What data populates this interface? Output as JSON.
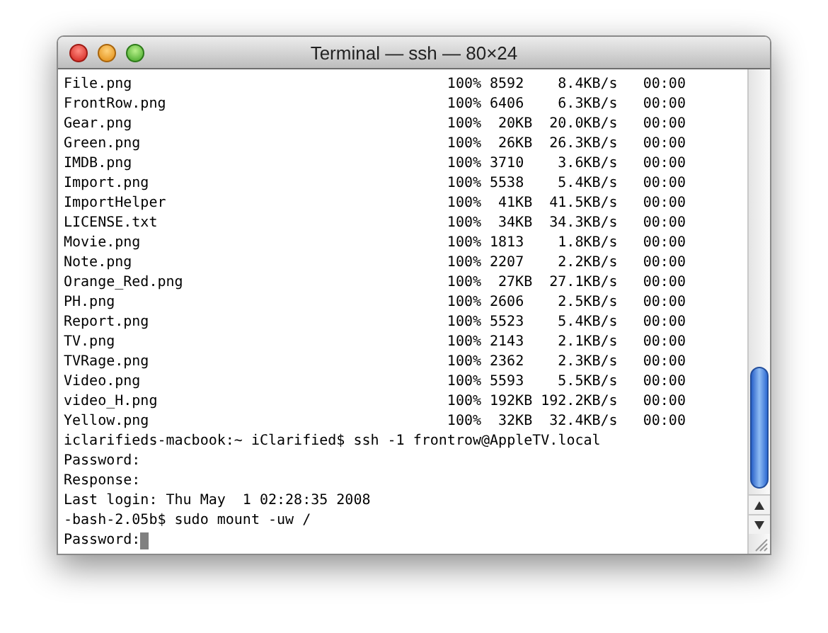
{
  "window": {
    "title": "Terminal — ssh — 80×24"
  },
  "transfers": [
    {
      "name": "File.png",
      "percent": "100%",
      "size": "8592",
      "rate": "8.4KB/s",
      "eta": "00:00"
    },
    {
      "name": "FrontRow.png",
      "percent": "100%",
      "size": "6406",
      "rate": "6.3KB/s",
      "eta": "00:00"
    },
    {
      "name": "Gear.png",
      "percent": "100%",
      "size": "20KB",
      "rate": "20.0KB/s",
      "eta": "00:00"
    },
    {
      "name": "Green.png",
      "percent": "100%",
      "size": "26KB",
      "rate": "26.3KB/s",
      "eta": "00:00"
    },
    {
      "name": "IMDB.png",
      "percent": "100%",
      "size": "3710",
      "rate": "3.6KB/s",
      "eta": "00:00"
    },
    {
      "name": "Import.png",
      "percent": "100%",
      "size": "5538",
      "rate": "5.4KB/s",
      "eta": "00:00"
    },
    {
      "name": "ImportHelper",
      "percent": "100%",
      "size": "41KB",
      "rate": "41.5KB/s",
      "eta": "00:00"
    },
    {
      "name": "LICENSE.txt",
      "percent": "100%",
      "size": "34KB",
      "rate": "34.3KB/s",
      "eta": "00:00"
    },
    {
      "name": "Movie.png",
      "percent": "100%",
      "size": "1813",
      "rate": "1.8KB/s",
      "eta": "00:00"
    },
    {
      "name": "Note.png",
      "percent": "100%",
      "size": "2207",
      "rate": "2.2KB/s",
      "eta": "00:00"
    },
    {
      "name": "Orange_Red.png",
      "percent": "100%",
      "size": "27KB",
      "rate": "27.1KB/s",
      "eta": "00:00"
    },
    {
      "name": "PH.png",
      "percent": "100%",
      "size": "2606",
      "rate": "2.5KB/s",
      "eta": "00:00"
    },
    {
      "name": "Report.png",
      "percent": "100%",
      "size": "5523",
      "rate": "5.4KB/s",
      "eta": "00:00"
    },
    {
      "name": "TV.png",
      "percent": "100%",
      "size": "2143",
      "rate": "2.1KB/s",
      "eta": "00:00"
    },
    {
      "name": "TVRage.png",
      "percent": "100%",
      "size": "2362",
      "rate": "2.3KB/s",
      "eta": "00:00"
    },
    {
      "name": "Video.png",
      "percent": "100%",
      "size": "5593",
      "rate": "5.5KB/s",
      "eta": "00:00"
    },
    {
      "name": "video_H.png",
      "percent": "100%",
      "size": "192KB",
      "rate": "192.2KB/s",
      "eta": "00:00"
    },
    {
      "name": "Yellow.png",
      "percent": "100%",
      "size": "32KB",
      "rate": "32.4KB/s",
      "eta": "00:00"
    }
  ],
  "session_lines": [
    "iclarifieds-macbook:~ iClarified$ ssh -1 frontrow@AppleTV.local",
    "Password:",
    "Response:",
    "Last login: Thu May  1 02:28:35 2008",
    "-bash-2.05b$ sudo mount -uw /",
    "Password:"
  ]
}
